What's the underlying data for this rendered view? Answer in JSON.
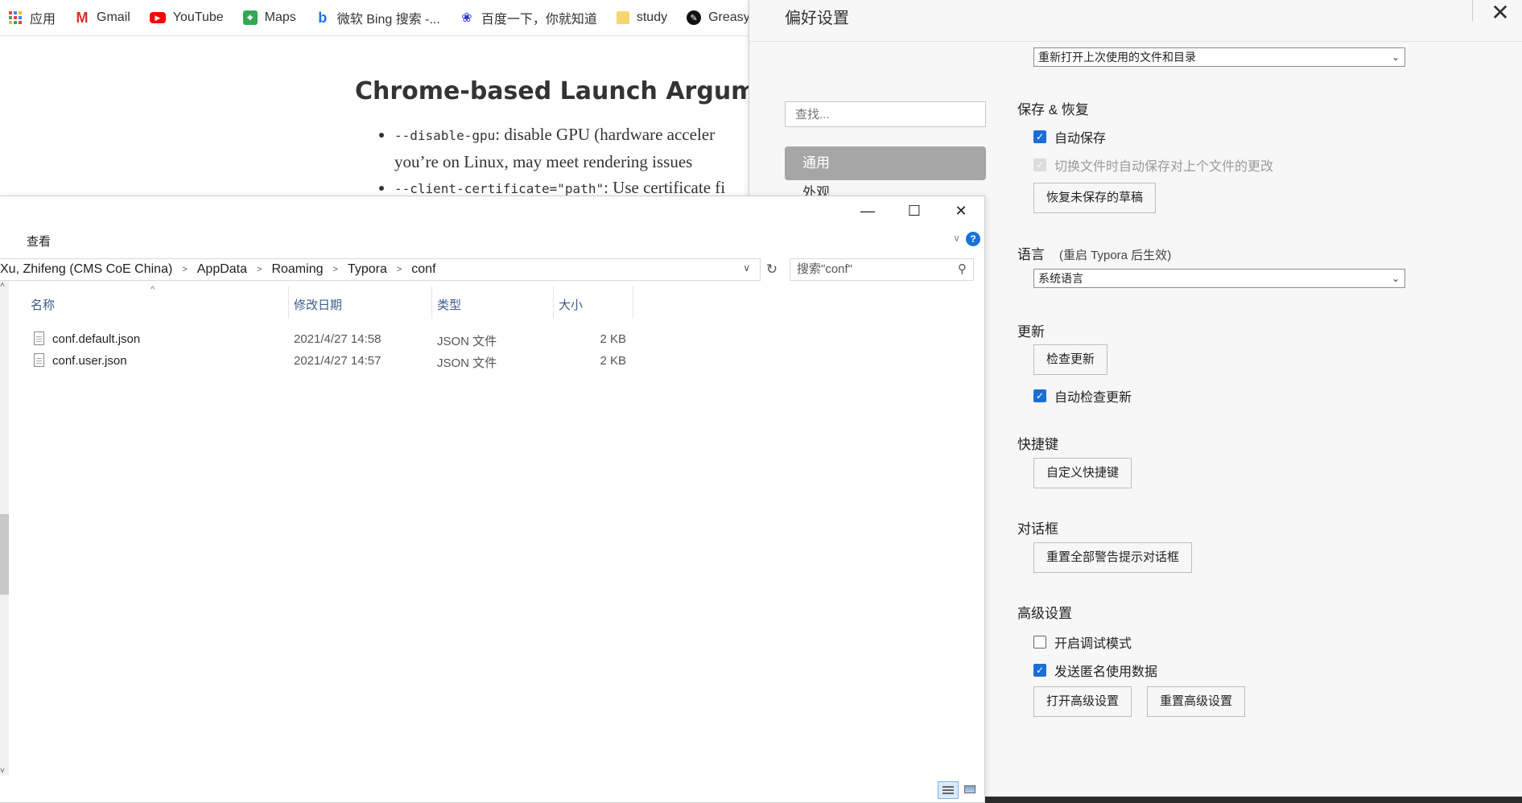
{
  "bookmarks": [
    {
      "label": "应用",
      "icon": "apps-grid-icon"
    },
    {
      "label": "Gmail",
      "icon": "gmail-icon"
    },
    {
      "label": "YouTube",
      "icon": "youtube-icon"
    },
    {
      "label": "Maps",
      "icon": "maps-icon"
    },
    {
      "label": "微软 Bing 搜索 -...",
      "icon": "bing-icon"
    },
    {
      "label": "百度一下，你就知道",
      "icon": "baidu-icon"
    },
    {
      "label": "study",
      "icon": "folder-icon"
    },
    {
      "label": "Greasy",
      "icon": "greasyfork-icon"
    }
  ],
  "document": {
    "heading": "Chrome-based Launch Argument",
    "bullet1_code": "--disable-gpu",
    "bullet1_text": ": disable GPU (hardware acceler",
    "bullet1_cont": "you’re on Linux, may meet rendering issues",
    "bullet2_code": "--client-certificate=\"path\"",
    "bullet2_text": ": Use certificate fi"
  },
  "preferences": {
    "title": "偏好设置",
    "close_glyph": "✕",
    "search_placeholder": "查找...",
    "nav": {
      "active": "通用",
      "next": "外观"
    },
    "startup_select": "重新打开上次使用的文件和目录",
    "save_section": "保存 & 恢复",
    "autosave": "自动保存",
    "autosave_on_switch": "切换文件时自动保存对上个文件的更改",
    "restore_drafts_btn": "恢复未保存的草稿",
    "language_section": "语言",
    "language_note": "(重启 Typora 后生效)",
    "language_select": "系统语言",
    "update_section": "更新",
    "check_update_btn": "检查更新",
    "auto_check_update": "自动检查更新",
    "shortcut_section": "快捷键",
    "custom_shortcut_btn": "自定义快捷键",
    "dialog_section": "对话框",
    "reset_dialogs_btn": "重置全部警告提示对话框",
    "advanced_section": "高级设置",
    "debug_mode": "开启调试模式",
    "send_usage": "发送匿名使用数据",
    "open_advanced_btn": "打开高级设置",
    "reset_advanced_btn": "重置高级设置",
    "states": {
      "autosave": true,
      "autosave_on_switch": true,
      "auto_check_update": true,
      "debug_mode": false,
      "send_usage": true
    }
  },
  "explorer": {
    "ribbon_tab": "查看",
    "breadcrumb": [
      "Xu, Zhifeng (CMS CoE China)",
      "AppData",
      "Roaming",
      "Typora",
      "conf"
    ],
    "search_placeholder": "搜索\"conf\"",
    "columns": {
      "name": "名称",
      "date": "修改日期",
      "type": "类型",
      "size": "大小"
    },
    "files": [
      {
        "name": "conf.default.json",
        "date": "2021/4/27 14:58",
        "type": "JSON 文件",
        "size": "2 KB"
      },
      {
        "name": "conf.user.json",
        "date": "2021/4/27 14:57",
        "type": "JSON 文件",
        "size": "2 KB"
      }
    ]
  },
  "colors": {
    "accent": "#1a6fd4",
    "nav_active": "#a6a6a6",
    "column_header": "#3b5c8c"
  }
}
